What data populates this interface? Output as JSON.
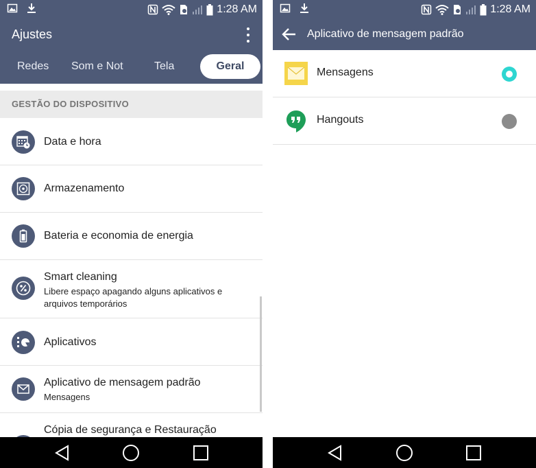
{
  "status_bar": {
    "time": "1:28 AM"
  },
  "left_screen": {
    "app_title": "Ajustes",
    "tabs": [
      {
        "label": "Redes"
      },
      {
        "label": "Som e Notificações"
      },
      {
        "label": "Tela"
      },
      {
        "label": "Geral",
        "active": true
      }
    ],
    "section_header": "GESTÃO DO DISPOSITIVO",
    "items": [
      {
        "title": "Data e hora",
        "icon": "calendar-clock-icon"
      },
      {
        "title": "Armazenamento",
        "icon": "storage-icon"
      },
      {
        "title": "Bateria e economia de energia",
        "icon": "battery-icon"
      },
      {
        "title": "Smart cleaning",
        "subtitle": "Libere espaço apagando alguns aplicativos e arquivos temporários",
        "icon": "percent-icon"
      },
      {
        "title": "Aplicativos",
        "icon": "apps-icon"
      },
      {
        "title": "Aplicativo de mensagem padrão",
        "subtitle": "Mensagens",
        "icon": "envelope-icon"
      },
      {
        "title": "Cópia de segurança e Restauração",
        "icon": "backup-icon"
      }
    ]
  },
  "right_screen": {
    "title": "Aplicativo de mensagem padrão",
    "options": [
      {
        "label": "Mensagens",
        "selected": true,
        "icon": "messages-app-icon"
      },
      {
        "label": "Hangouts",
        "selected": false,
        "icon": "hangouts-app-icon"
      }
    ]
  },
  "colors": {
    "header": "#4e5a77",
    "radio_selected": "#2ed6d1",
    "radio_unselected": "#8b8b8b",
    "hangouts_green": "#1e9e58",
    "messages_yellow": "#f5d54a"
  }
}
